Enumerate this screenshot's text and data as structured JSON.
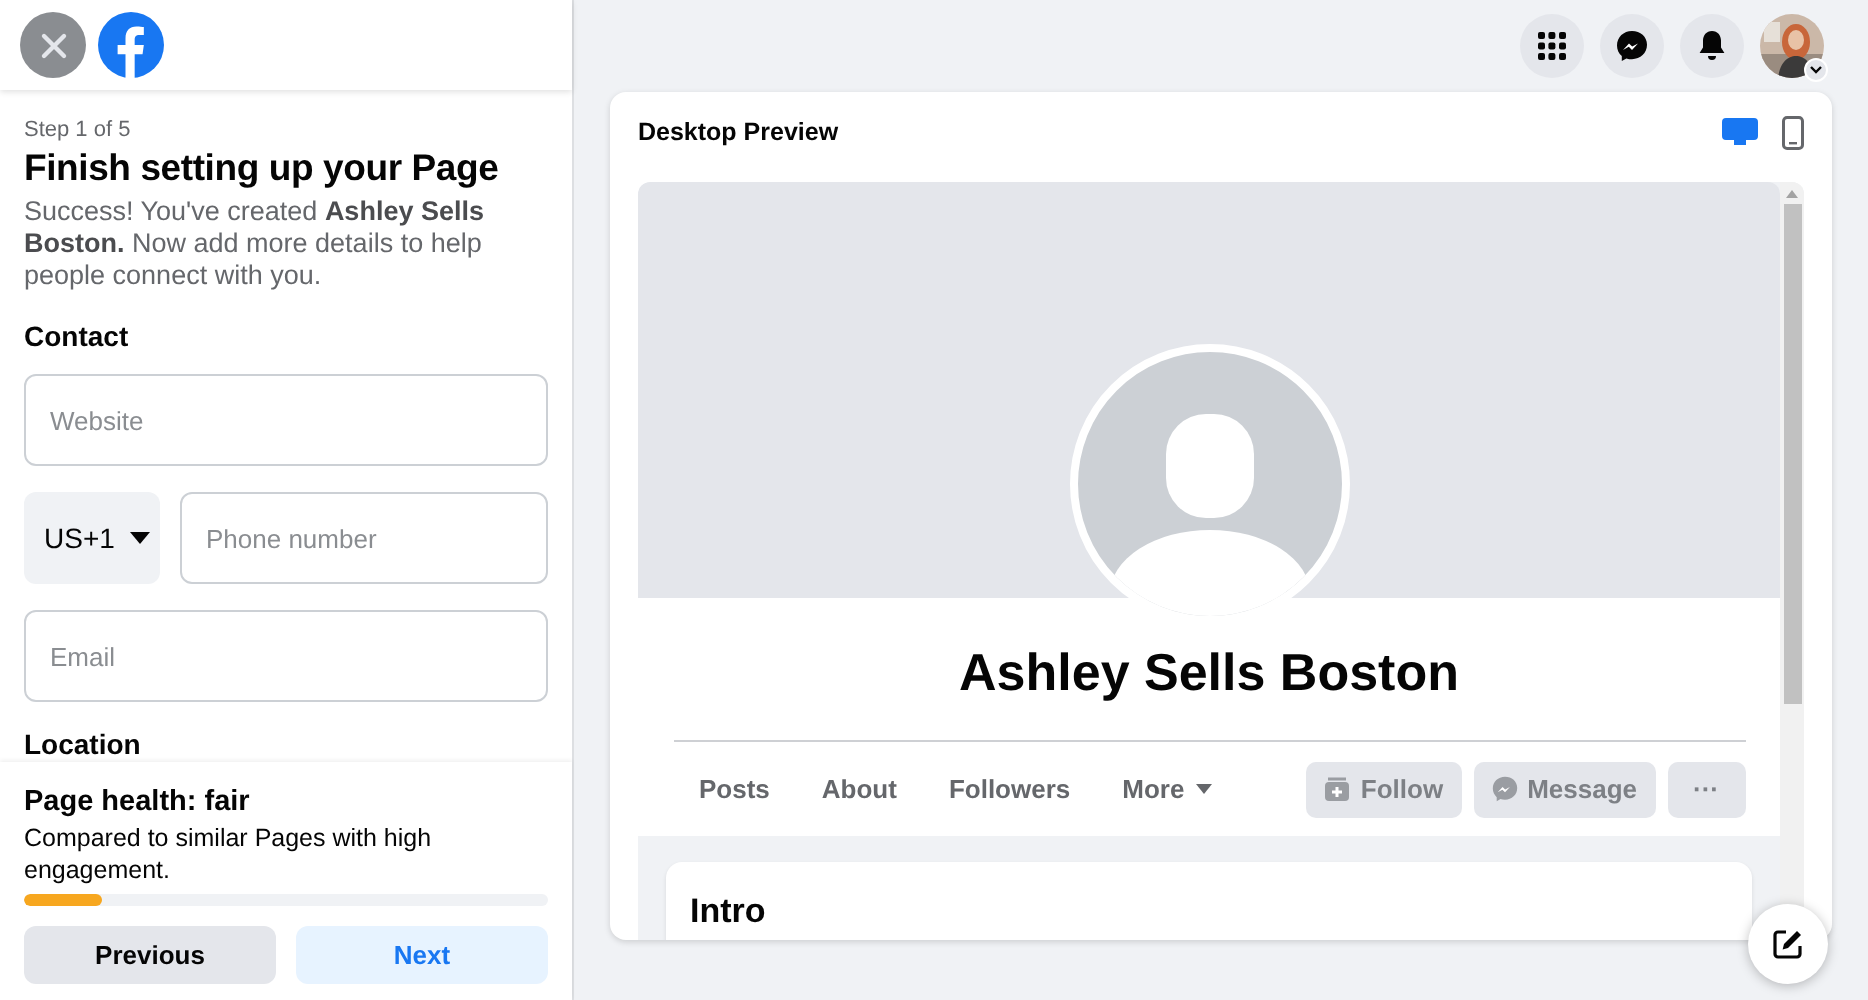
{
  "setup": {
    "step": "Step 1 of 5",
    "title": "Finish setting up your Page",
    "intro": "Success! You've created **Ashley Sells Boston.** Now add more details to help people connect with you.",
    "contact_heading": "Contact",
    "fields": [
      {
        "kind": "text",
        "placeholder": "Website"
      },
      {
        "kind": "phone",
        "country": "US+1",
        "placeholder": "Phone number"
      },
      {
        "kind": "text",
        "placeholder": "Email"
      }
    ],
    "location_heading": "Location"
  },
  "page_health": {
    "title": "Page health: fair",
    "description": "Compared to similar Pages with high engagement.",
    "level": 0.15,
    "color": "#f7a71f"
  },
  "buttons": [
    {
      "label": "Previous",
      "kind": "secondary"
    },
    {
      "label": "Next",
      "kind": "primary"
    }
  ],
  "preview": {
    "title": "Desktop Preview",
    "view_toggles": [
      {
        "kind": "desktop",
        "selected": true
      },
      {
        "kind": "mobile",
        "selected": false
      }
    ],
    "page_name": "Ashley Sells Boston",
    "tabs": [
      {
        "label": "Posts"
      },
      {
        "label": "About"
      },
      {
        "label": "Followers"
      },
      {
        "label": "More",
        "dropdown": true
      }
    ],
    "actions": [
      {
        "label": "Follow",
        "kind": "follow",
        "disabled": true
      },
      {
        "label": "Message",
        "kind": "message",
        "disabled": true
      },
      {
        "label": "···",
        "kind": "more",
        "disabled": true
      }
    ],
    "intro_heading": "Intro"
  }
}
